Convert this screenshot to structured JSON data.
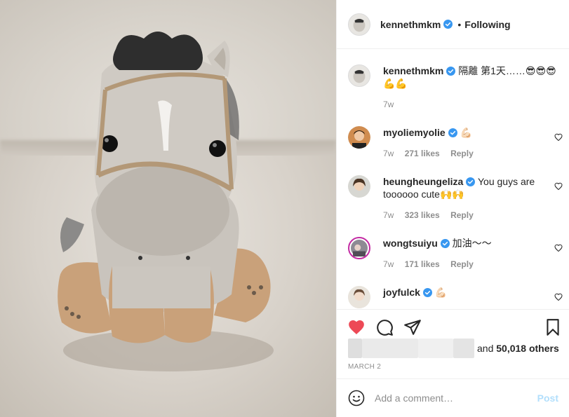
{
  "post": {
    "author": "kennethmkm",
    "follow_status": "Following",
    "separator": "•",
    "caption_user": "kennethmkm",
    "caption_text": "隔離 第1天……😎😎😎💪💪",
    "caption_age": "7w",
    "date": "MARCH 2",
    "likes_suffix": "and",
    "likes_count": "50,018 others",
    "add_comment_placeholder": "Add a comment…",
    "post_button": "Post",
    "verified_color": "#3897f0",
    "like_color": "#ed4956"
  },
  "comments": [
    {
      "user": "myoliemyolie",
      "text": "💪🏻",
      "age": "7w",
      "likes": "271 likes",
      "reply": "Reply"
    },
    {
      "user": "heungheungeliza",
      "text": "You guys are toooooo cute🙌🙌",
      "age": "7w",
      "likes": "323 likes",
      "reply": "Reply"
    },
    {
      "user": "wongtsuiyu",
      "text": "加油～～",
      "age": "7w",
      "likes": "171 likes",
      "reply": "Reply"
    },
    {
      "user": "joyfulck",
      "text": "💪🏻",
      "age": "",
      "likes": "",
      "reply": ""
    }
  ],
  "icons": [
    "heart-icon",
    "comment-icon",
    "share-icon",
    "bookmark-icon",
    "emoji-icon",
    "verified-icon",
    "small-heart-icon"
  ]
}
